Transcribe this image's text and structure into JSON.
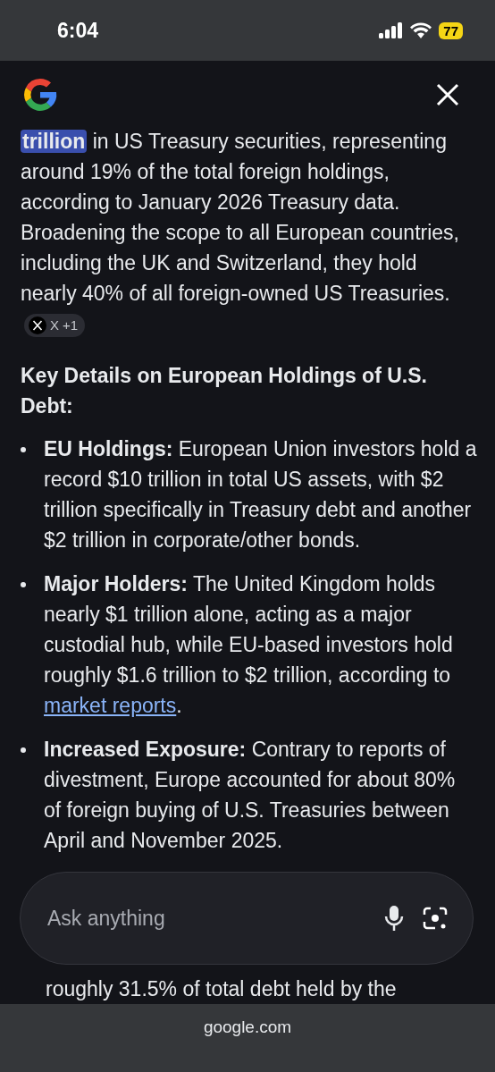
{
  "status_bar": {
    "time": "6:04",
    "battery": "77"
  },
  "answer": {
    "paragraph": "**trillion** in US Treasury securities, representing around 19% of the total foreign holdings, according to January 2026 Treasury data. Broadening the scope to all European countries, including the UK and Switzerland, they hold nearly 40% of all foreign-owned US Treasuries.",
    "source_chip": {
      "name": "X",
      "extra": "+1"
    },
    "heading": "Key Details on European Holdings of U.S. Debt:",
    "bullets": [
      {
        "lead": "EU Holdings:",
        "text": "European Union investors hold a record $10 trillion in total US assets, with $2 trillion specifically in Treasury debt and another $2 trillion in corporate/other bonds."
      },
      {
        "lead": "Major Holders:",
        "text": "The United Kingdom holds nearly $1 trillion alone, acting as a major custodial hub, while EU-based investors hold roughly $1.6 trillion to $2 trillion, according to",
        "link": "market reports",
        "tail": "."
      },
      {
        "lead": "Increased Exposure:",
        "text": "Contrary to reports of divestment, Europe accounted for about 80% of foreign buying of U.S. Treasuries between April and November 2025."
      }
    ],
    "partial_line": "roughly 31.5% of total debt held by the"
  },
  "ask_bar": {
    "placeholder": "Ask anything"
  },
  "address_bar": {
    "domain": "google.com"
  }
}
